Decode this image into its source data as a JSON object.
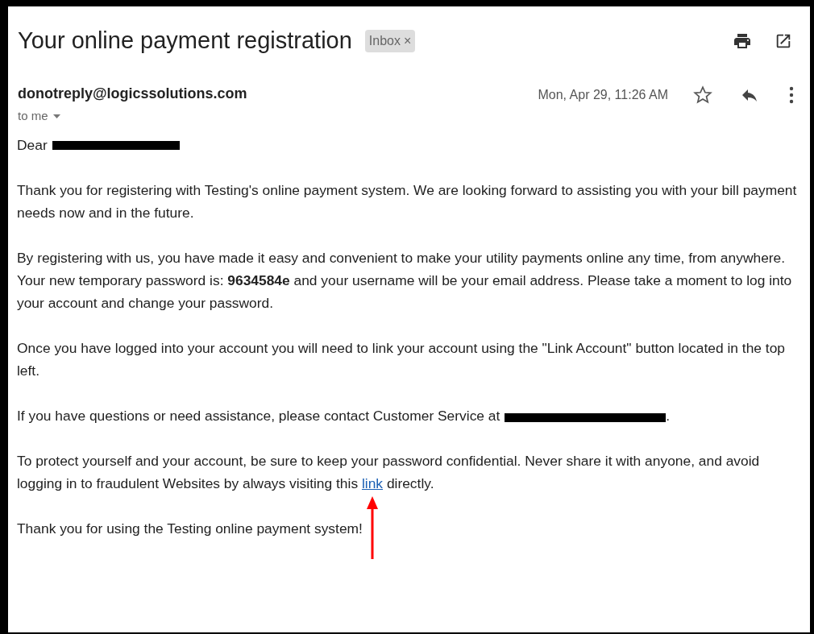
{
  "subject": "Your online payment registration",
  "label": {
    "text": "Inbox",
    "remove": "×"
  },
  "sender": "donotreply@logicssolutions.com",
  "recipient": "to me",
  "date": "Mon, Apr 29, 11:26 AM",
  "greeting": "Dear",
  "paragraphs": [
    {
      "kind": "text",
      "lines": [
        "Thank you for registering with Testing's online payment system. We are looking forward to assisting you with your bill payment needs now and in the future."
      ]
    },
    {
      "kind": "text",
      "lines": [
        "By registering with us, you have made it easy and convenient to make your utility payments online any time, from anywhere.",
        "Your new temporary password is: **9634584e** and your username will be your email address. Please take a moment to log into your account and change your password."
      ]
    },
    {
      "kind": "text",
      "lines": [
        "Once you have logged into your account you will need to link your account using the \"Link Account\" button located in the top left."
      ]
    },
    {
      "kind": "redacted",
      "before": "If you have questions or need assistance, please contact Customer Service at",
      "after": "."
    },
    {
      "kind": "link",
      "before": "To protect yourself and your account, be sure to keep your password confidential. Never share it with anyone, and avoid logging in to fraudulent Websites by always visiting this",
      "link": "link",
      "after": "directly."
    },
    {
      "kind": "text",
      "lines": [
        "Thank you for using the Testing online payment system!"
      ]
    }
  ]
}
